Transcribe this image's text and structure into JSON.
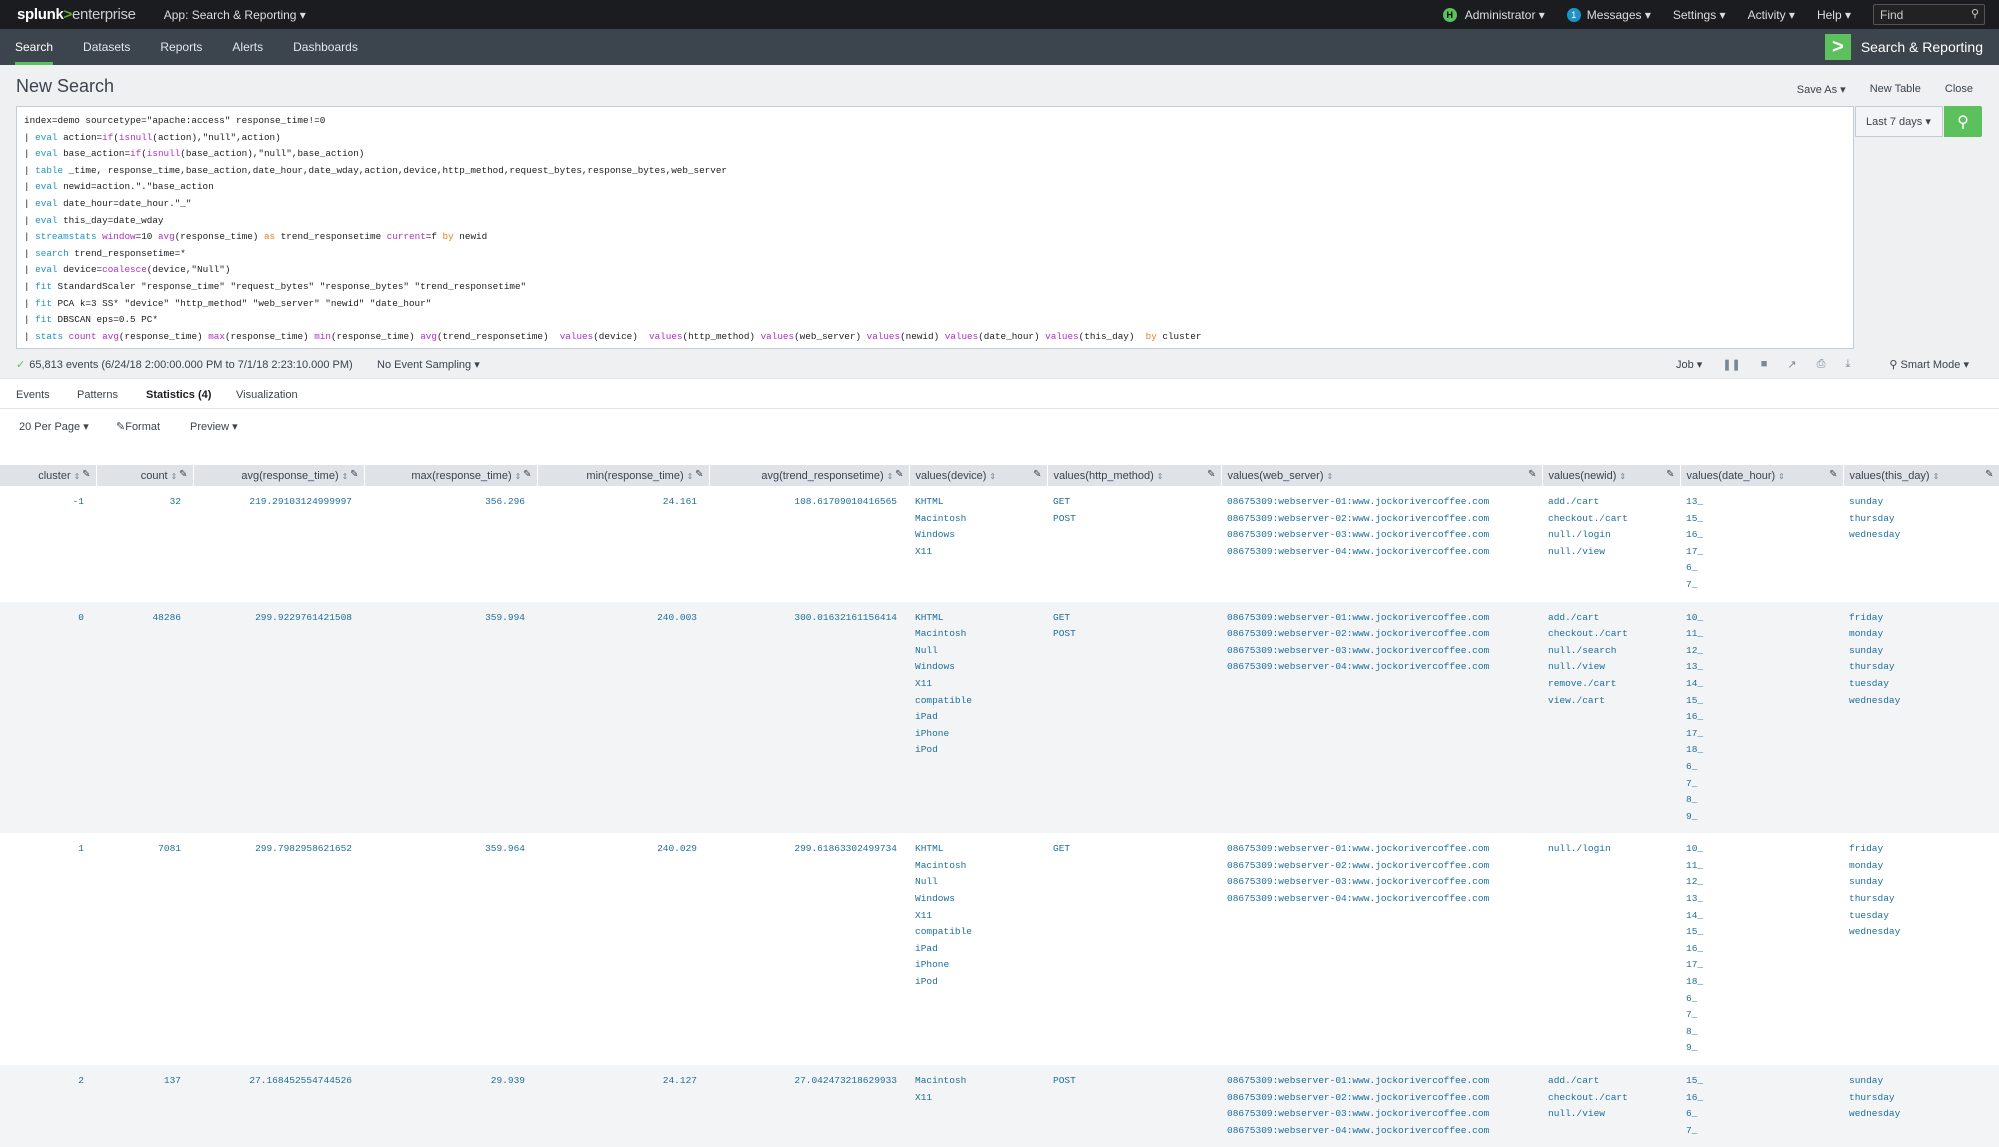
{
  "topbar": {
    "logo": {
      "a": "splunk",
      "g": ">",
      "b": "enterprise"
    },
    "app_menu": "App: Search & Reporting ▾",
    "user": {
      "initial": "H",
      "label": "Administrator ▾"
    },
    "messages": {
      "count": "1",
      "label": "Messages ▾"
    },
    "settings": "Settings ▾",
    "activity": "Activity ▾",
    "help": "Help ▾",
    "find_placeholder": "Find"
  },
  "navbar": {
    "items": [
      "Search",
      "Datasets",
      "Reports",
      "Alerts",
      "Dashboards"
    ],
    "app_title": "Search & Reporting"
  },
  "header": {
    "title": "New Search",
    "save_as": "Save As ▾",
    "new_table": "New Table",
    "close": "Close"
  },
  "search": {
    "time_range": "Last 7 days ▾"
  },
  "status": {
    "events": "65,813 events (6/24/18 2:00:00.000 PM to 7/1/18 2:23:10.000 PM)",
    "sampling": "No Event Sampling ▾",
    "job": "Job ▾",
    "mode": "Smart Mode ▾"
  },
  "tabs": [
    "Events",
    "Patterns",
    "Statistics (4)",
    "Visualization"
  ],
  "table_opts": {
    "per_page": "20 Per Page ▾",
    "format": "Format",
    "preview": "Preview ▾"
  },
  "columns": [
    "cluster",
    "count",
    "avg(response_time)",
    "max(response_time)",
    "min(response_time)",
    "avg(trend_responsetime)",
    "values(device)",
    "values(http_method)",
    "values(web_server)",
    "values(newid)",
    "values(date_hour)",
    "values(this_day)"
  ],
  "rows": [
    {
      "cluster": "-1",
      "count": "32",
      "avg": "219.29103124999997",
      "max": "356.296",
      "min": "24.161",
      "trend": "108.61709010416565",
      "device": "KHTML\nMacintosh\nWindows\nX11",
      "method": "GET\nPOST",
      "server": "08675309:webserver-01:www.jockorivercoffee.com\n08675309:webserver-02:www.jockorivercoffee.com\n08675309:webserver-03:www.jockorivercoffee.com\n08675309:webserver-04:www.jockorivercoffee.com",
      "newid": "add./cart\ncheckout./cart\nnull./login\nnull./view",
      "hour": "13_\n15_\n16_\n17_\n6_\n7_",
      "day": "sunday\nthursday\nwednesday"
    },
    {
      "cluster": "0",
      "count": "48286",
      "avg": "299.9229761421508",
      "max": "359.994",
      "min": "240.003",
      "trend": "300.01632161156414",
      "device": "KHTML\nMacintosh\nNull\nWindows\nX11\ncompatible\niPad\niPhone\niPod",
      "method": "GET\nPOST",
      "server": "08675309:webserver-01:www.jockorivercoffee.com\n08675309:webserver-02:www.jockorivercoffee.com\n08675309:webserver-03:www.jockorivercoffee.com\n08675309:webserver-04:www.jockorivercoffee.com",
      "newid": "add./cart\ncheckout./cart\nnull./search\nnull./view\nremove./cart\nview./cart",
      "hour": "10_\n11_\n12_\n13_\n14_\n15_\n16_\n17_\n18_\n6_\n7_\n8_\n9_",
      "day": "friday\nmonday\nsunday\nthursday\ntuesday\nwednesday"
    },
    {
      "cluster": "1",
      "count": "7081",
      "avg": "299.7982958621652",
      "max": "359.964",
      "min": "240.029",
      "trend": "299.61863302499734",
      "device": "KHTML\nMacintosh\nNull\nWindows\nX11\ncompatible\niPad\niPhone\niPod",
      "method": "GET",
      "server": "08675309:webserver-01:www.jockorivercoffee.com\n08675309:webserver-02:www.jockorivercoffee.com\n08675309:webserver-03:www.jockorivercoffee.com\n08675309:webserver-04:www.jockorivercoffee.com",
      "newid": "null./login",
      "hour": "10_\n11_\n12_\n13_\n14_\n15_\n16_\n17_\n18_\n6_\n7_\n8_\n9_",
      "day": "friday\nmonday\nsunday\nthursday\ntuesday\nwednesday"
    },
    {
      "cluster": "2",
      "count": "137",
      "avg": "27.168452554744526",
      "max": "29.939",
      "min": "24.127",
      "trend": "27.042473218629933",
      "device": "Macintosh\nX11",
      "method": "POST",
      "server": "08675309:webserver-01:www.jockorivercoffee.com\n08675309:webserver-02:www.jockorivercoffee.com\n08675309:webserver-03:www.jockorivercoffee.com\n08675309:webserver-04:www.jockorivercoffee.com",
      "newid": "add./cart\ncheckout./cart\nnull./view",
      "hour": "15_\n16_\n6_\n7_",
      "day": "sunday\nthursday\nwednesday"
    }
  ]
}
